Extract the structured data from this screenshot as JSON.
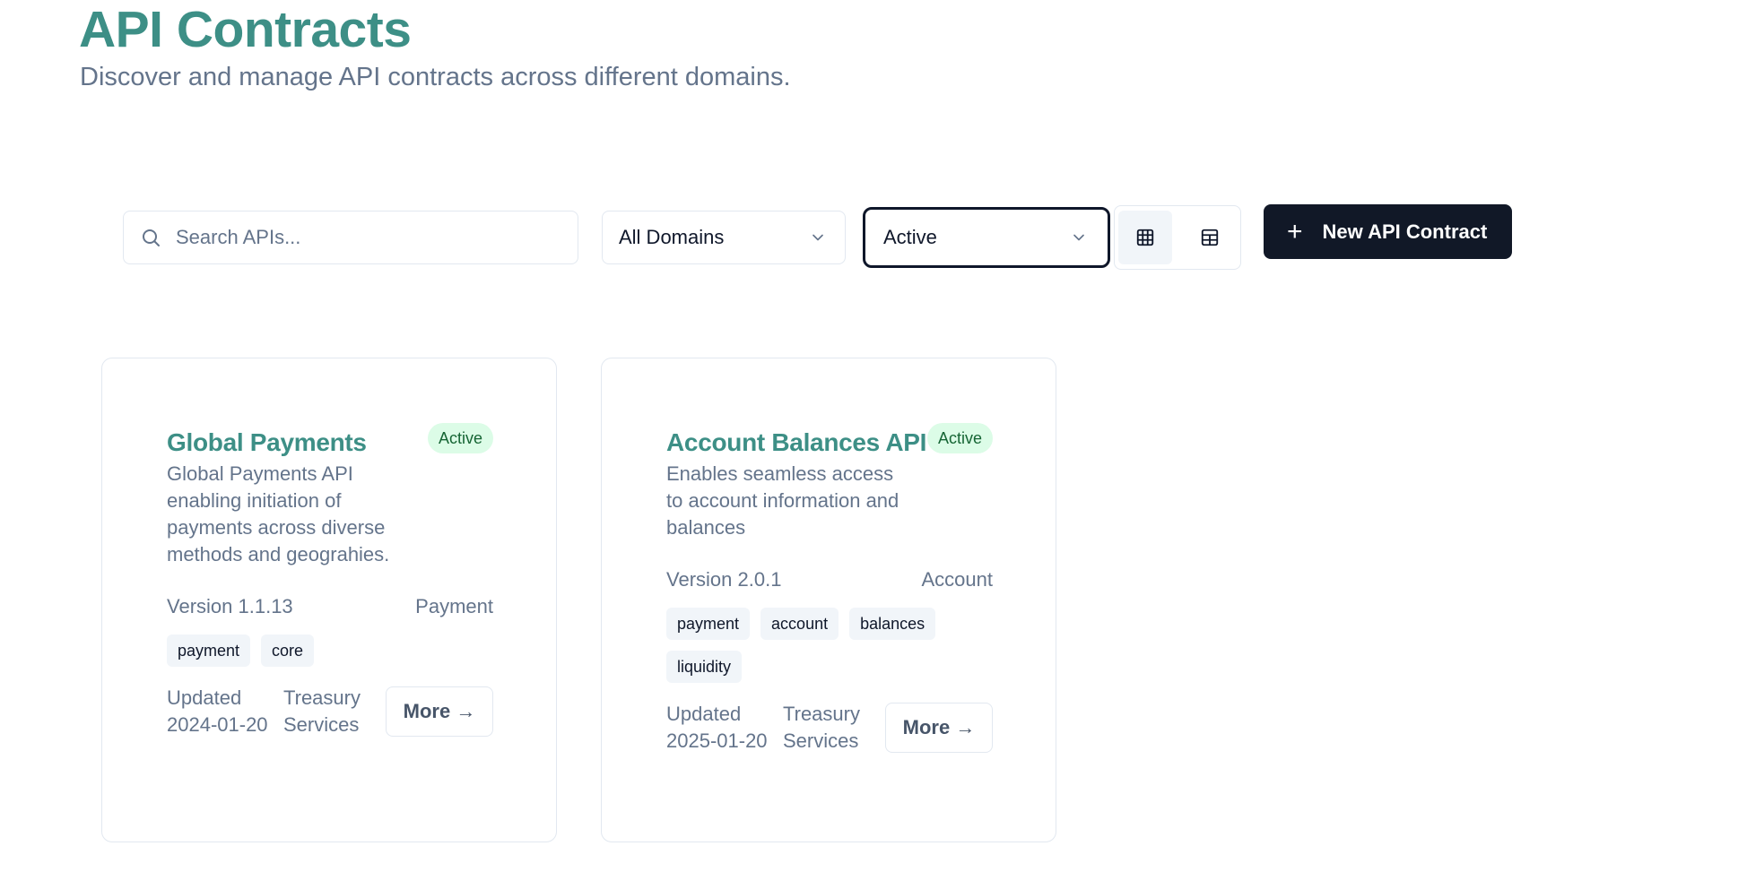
{
  "header": {
    "title": "API Contracts",
    "subtitle": "Discover and manage API contracts across different domains."
  },
  "toolbar": {
    "search_placeholder": "Search APIs...",
    "domain_filter": "All Domains",
    "status_filter": "Active",
    "new_button_label": "New API Contract"
  },
  "icons": {
    "search": "search-icon",
    "chevron": "chevron-down-icon",
    "grid": "grid-icon",
    "table": "table-icon",
    "plus": "plus-icon"
  },
  "colors": {
    "accent": "#3d8f86",
    "primary_button": "#111827",
    "badge_bg": "#dcfce7",
    "badge_text": "#166534"
  },
  "cards": [
    {
      "title": "Global Payments",
      "status": "Active",
      "description": "Global Payments API enabling initiation of payments across diverse methods and geograhies.",
      "version": "Version 1.1.13",
      "domain": "Payment",
      "tags": [
        "payment",
        "core"
      ],
      "updated": "Updated 2024-01-20",
      "owner": "Treasury Services",
      "more_label": "More →"
    },
    {
      "title": "Account Balances API",
      "status": "Active",
      "description": "Enables seamless access to account information and balances",
      "version": "Version 2.0.1",
      "domain": "Account",
      "tags": [
        "payment",
        "account",
        "balances",
        "liquidity"
      ],
      "updated": "Updated 2025-01-20",
      "owner": "Treasury Services",
      "more_label": "More →"
    }
  ]
}
